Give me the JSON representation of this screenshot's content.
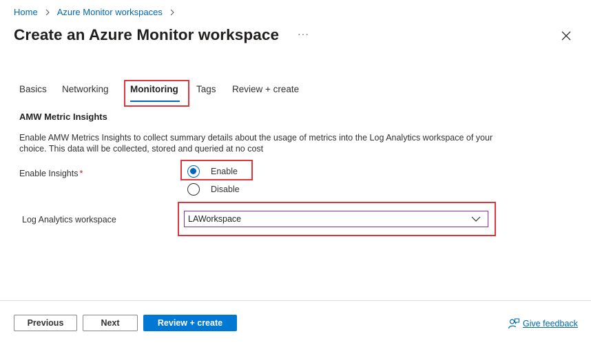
{
  "breadcrumb": {
    "home": "Home",
    "parent": "Azure Monitor workspaces"
  },
  "header": {
    "title": "Create an Azure Monitor workspace",
    "more": "···"
  },
  "tabs": [
    {
      "label": "Basics",
      "active": false
    },
    {
      "label": "Networking",
      "active": false
    },
    {
      "label": "Monitoring",
      "active": true
    },
    {
      "label": "Tags",
      "active": false
    },
    {
      "label": "Review + create",
      "active": false
    }
  ],
  "section": {
    "title": "AMW Metric Insights",
    "description": "Enable AMW Metrics Insights to collect summary details about the usage of metrics into the Log Analytics workspace of your choice. This data will be collected, stored and queried at no cost"
  },
  "insights": {
    "label": "Enable Insights",
    "required_mark": "*",
    "options": [
      {
        "label": "Enable",
        "selected": true
      },
      {
        "label": "Disable",
        "selected": false
      }
    ]
  },
  "workspace": {
    "label": "Log Analytics workspace",
    "value": "LAWorkspace"
  },
  "footer": {
    "previous": "Previous",
    "next": "Next",
    "review_create": "Review + create",
    "feedback": "Give feedback"
  },
  "colors": {
    "accent": "#0078d4",
    "link": "#0067b8",
    "highlight": "#e3343c",
    "required": "#a4262c"
  }
}
